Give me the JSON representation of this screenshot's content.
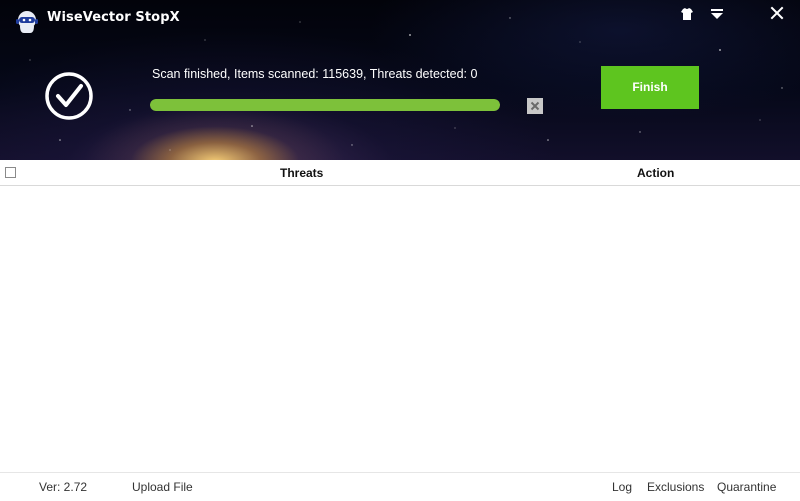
{
  "app": {
    "title": "WiseVector StopX"
  },
  "window_controls": [
    {
      "icon": "tshirt-skin-icon"
    },
    {
      "icon": "menu-dropdown-icon"
    },
    {
      "icon": "close-icon"
    }
  ],
  "scan": {
    "status_text": "Scan finished, Items scanned: 115639, Threats detected: 0",
    "progress": 1.0,
    "finish_label": "Finish"
  },
  "table": {
    "columns": [
      "Threats",
      "Action"
    ],
    "rows": []
  },
  "footer": {
    "version": "Ver: 2.72",
    "upload_file": "Upload File",
    "log": "Log",
    "exclusions": "Exclusions",
    "quarantine": "Quarantine"
  },
  "colors": {
    "accent_green": "#5ec51f",
    "progress_green": "#7dc13a"
  }
}
